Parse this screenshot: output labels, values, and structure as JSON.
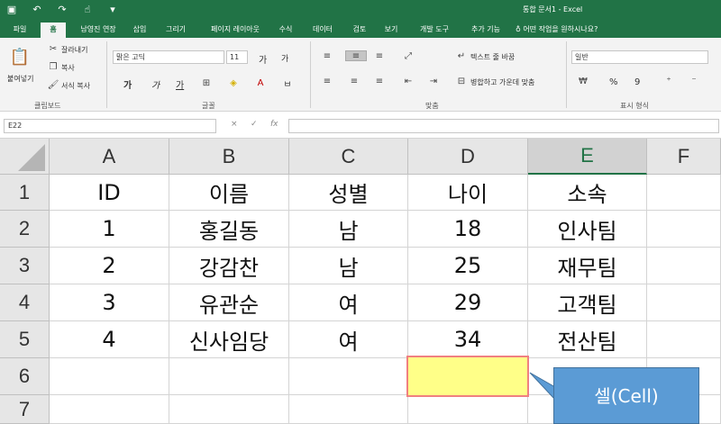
{
  "titlebar": {
    "title": "통합 문서1 - Excel"
  },
  "tabs": [
    "파일",
    "홈",
    "남영진 연장",
    "삽입",
    "그리기",
    "페이지 레이아웃",
    "수식",
    "데이터",
    "검토",
    "보기",
    "개발 도구",
    "추가 기능",
    "어떤 작업을 원하시나요?"
  ],
  "ribbon": {
    "clipboard": {
      "paste": "붙여넣기",
      "cut": "잘라내기",
      "copy": "복사",
      "format_painter": "서식 복사",
      "label": "클립보드"
    },
    "font": {
      "font_name": "맑은 고딕",
      "font_size": "11",
      "label": "글꼴",
      "bold": "가",
      "italic": "가",
      "underline": "가",
      "increase": "가",
      "decrease": "가"
    },
    "alignment": {
      "wrap_text": "텍스트 줄 바꿈",
      "merge_center": "병합하고 가운데 맞춤",
      "label": "맞춤"
    },
    "number": {
      "format": "일반",
      "percent": "%",
      "comma": "9",
      "label": "표시 형식"
    }
  },
  "formula_bar": {
    "name_box": "E22",
    "cancel": "×",
    "enter": "✓",
    "fx": "fx"
  },
  "sheet": {
    "columns": [
      "A",
      "B",
      "C",
      "D",
      "E",
      "F"
    ],
    "rows": [
      "1",
      "2",
      "3",
      "4",
      "5",
      "6",
      "7"
    ],
    "cells": [
      [
        "ID",
        "이름",
        "성별",
        "나이",
        "소속"
      ],
      [
        "1",
        "홍길동",
        "남",
        "18",
        "인사팀"
      ],
      [
        "2",
        "강감찬",
        "남",
        "25",
        "재무팀"
      ],
      [
        "3",
        "유관순",
        "여",
        "29",
        "고객팀"
      ],
      [
        "4",
        "신사임당",
        "여",
        "34",
        "전산팀"
      ]
    ],
    "selected_column": "E"
  },
  "callout": {
    "text": "셀(Cell)"
  },
  "colors": {
    "brand": "#217346",
    "highlight_fill": "#ffff88",
    "highlight_border": "#f08080",
    "callout": "#5b9bd5"
  }
}
